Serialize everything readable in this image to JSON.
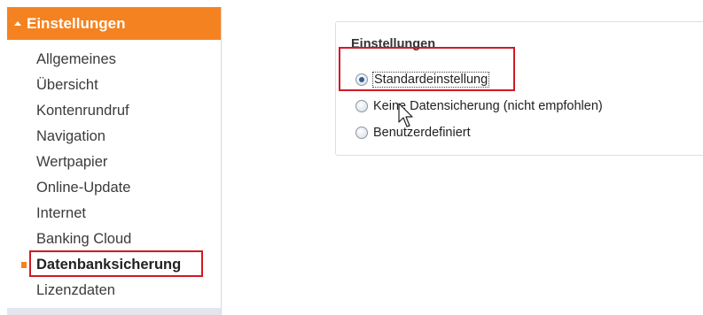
{
  "sidebar": {
    "header_title": "Einstellungen",
    "items": [
      {
        "label": "Allgemeines"
      },
      {
        "label": "Übersicht"
      },
      {
        "label": "Kontenrundruf"
      },
      {
        "label": "Navigation"
      },
      {
        "label": "Wertpapier"
      },
      {
        "label": "Online-Update"
      },
      {
        "label": "Internet"
      },
      {
        "label": "Banking Cloud"
      },
      {
        "label": "Datenbanksicherung",
        "active": true
      },
      {
        "label": "Lizenzdaten"
      }
    ]
  },
  "settings_panel": {
    "title": "Einstellungen",
    "options": [
      {
        "label": "Standardeinstellung",
        "selected": true
      },
      {
        "label": "Keine Datensicherung (nicht empfohlen)",
        "selected": false
      },
      {
        "label": "Benutzerdefiniert",
        "selected": false
      }
    ]
  },
  "colors": {
    "accent": "#f58220",
    "highlight_box": "#d01a25",
    "radio_dot": "#2d5f9a"
  },
  "icons": {
    "header_caret": "caret-up-icon",
    "cursor": "mouse-pointer-icon"
  }
}
